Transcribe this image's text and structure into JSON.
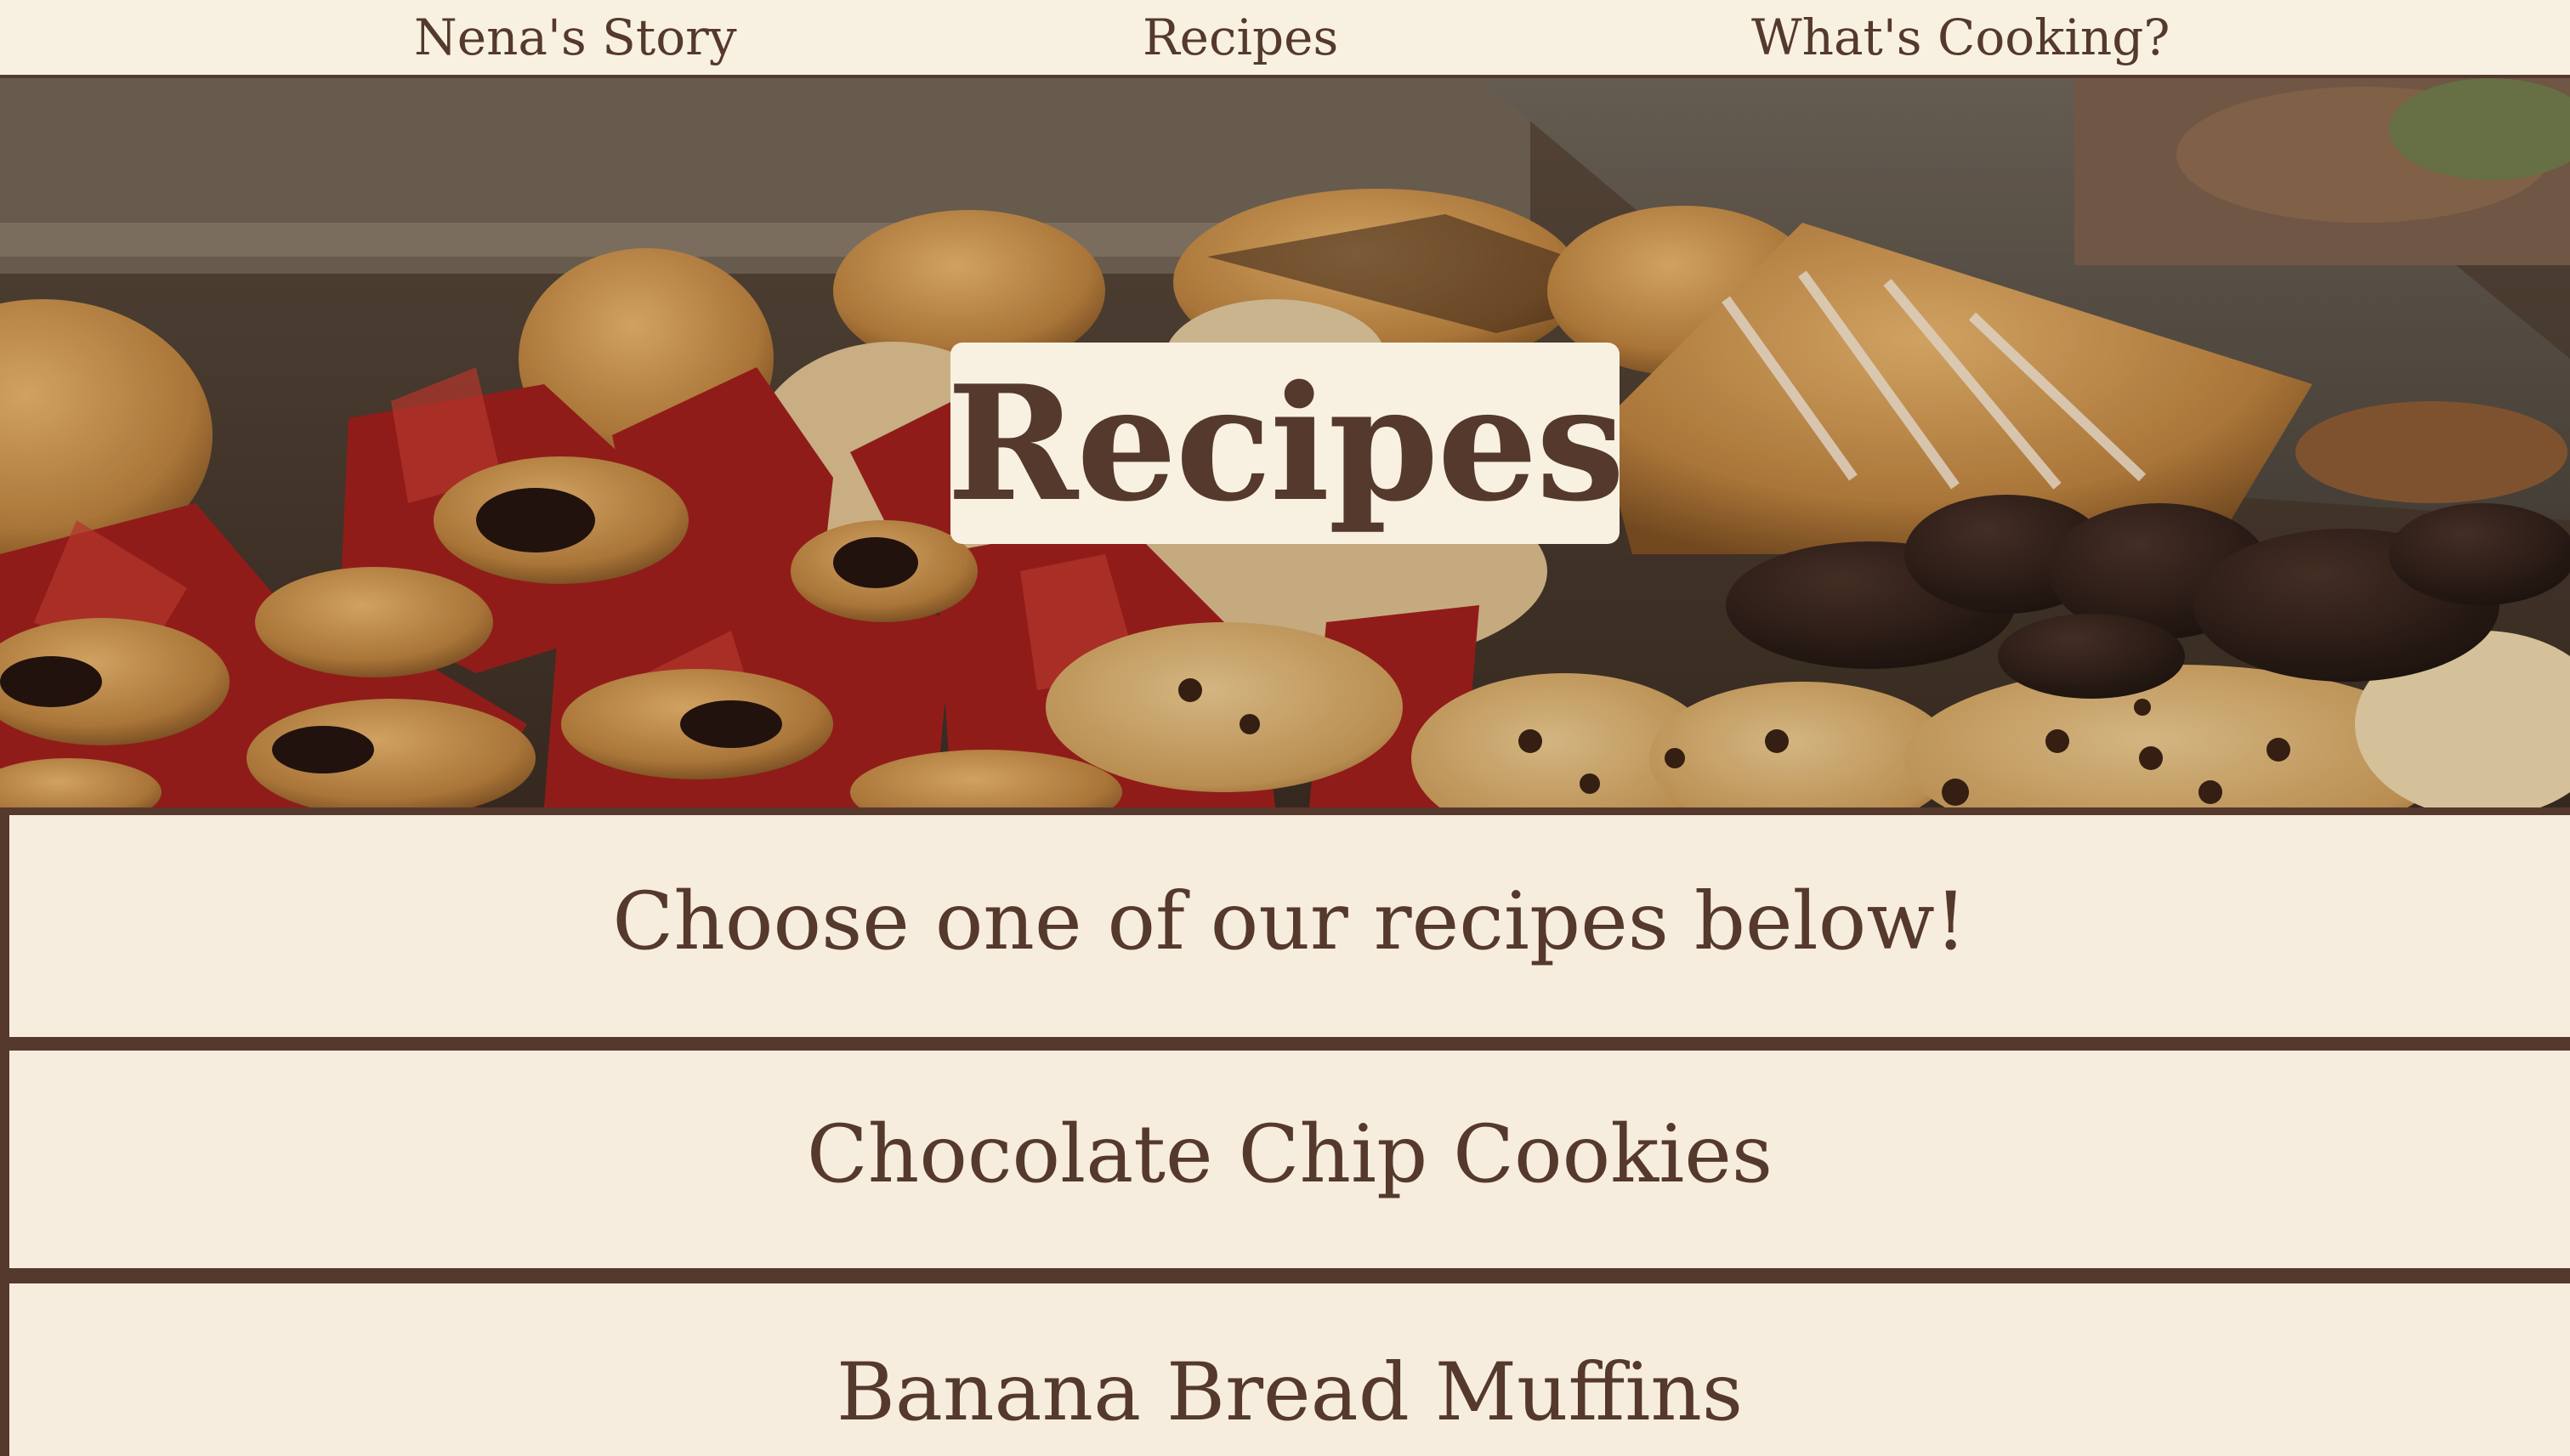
{
  "nav": {
    "story_label": "Nena's Story",
    "recipes_label": "Recipes",
    "cooking_label": "What's Cooking?"
  },
  "hero": {
    "title": "Recipes",
    "image": "bakery-pastries-photo"
  },
  "content": {
    "intro": "Choose one of our recipes below!",
    "recipes": [
      {
        "label": "Chocolate Chip Cookies"
      },
      {
        "label": "Banana Bread Muffins"
      }
    ]
  },
  "colors": {
    "brand_brown": "#55392d",
    "cream": "#f8f1e2",
    "panel_cream": "#f7eddf"
  }
}
